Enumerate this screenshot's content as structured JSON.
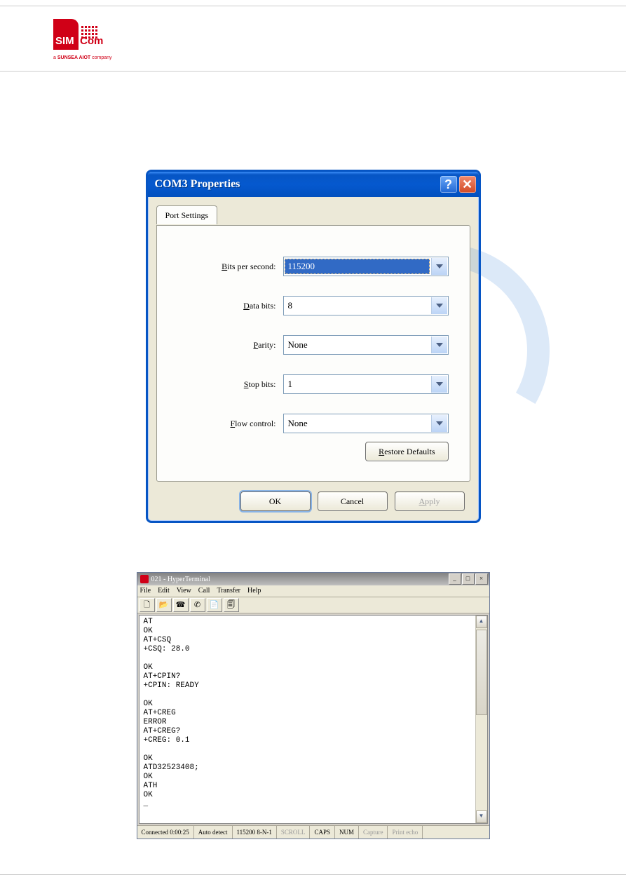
{
  "logo": {
    "sim": "SIM",
    "com": "Com",
    "sub_prefix": "a ",
    "sub_bold": "SUNSEA AIOT",
    "sub_suffix": " company"
  },
  "dialog": {
    "title": "COM3 Properties",
    "tab": "Port Settings",
    "fields": {
      "bps": {
        "label_pre": "",
        "u": "B",
        "label_post": "its per second:",
        "value": "115200"
      },
      "data": {
        "label_pre": "",
        "u": "D",
        "label_post": "ata bits:",
        "value": "8"
      },
      "parity": {
        "label_pre": "",
        "u": "P",
        "label_post": "arity:",
        "value": "None"
      },
      "stop": {
        "label_pre": "",
        "u": "S",
        "label_post": "top bits:",
        "value": "1"
      },
      "flow": {
        "label_pre": "",
        "u": "F",
        "label_post": "low control:",
        "value": "None"
      }
    },
    "restore_u": "R",
    "restore_post": "estore Defaults",
    "ok": "OK",
    "cancel": "Cancel",
    "apply_u": "A",
    "apply_post": "pply"
  },
  "hyper": {
    "title": "021 - HyperTerminal",
    "menu": [
      "File",
      "Edit",
      "View",
      "Call",
      "Transfer",
      "Help"
    ],
    "body": "AT\nOK\nAT+CSQ\n+CSQ: 28.0\n\nOK\nAT+CPIN?\n+CPIN: READY\n\nOK\nAT+CREG\nERROR\nAT+CREG?\n+CREG: 0.1\n\nOK\nATD32523408;\nOK\nATH\nOK\n_",
    "status": {
      "conn": "Connected 0:00:25",
      "auto": "Auto detect",
      "baud": "115200 8-N-1",
      "scroll": "SCROLL",
      "caps": "CAPS",
      "num": "NUM",
      "capture": "Capture",
      "echo": "Print echo"
    }
  }
}
